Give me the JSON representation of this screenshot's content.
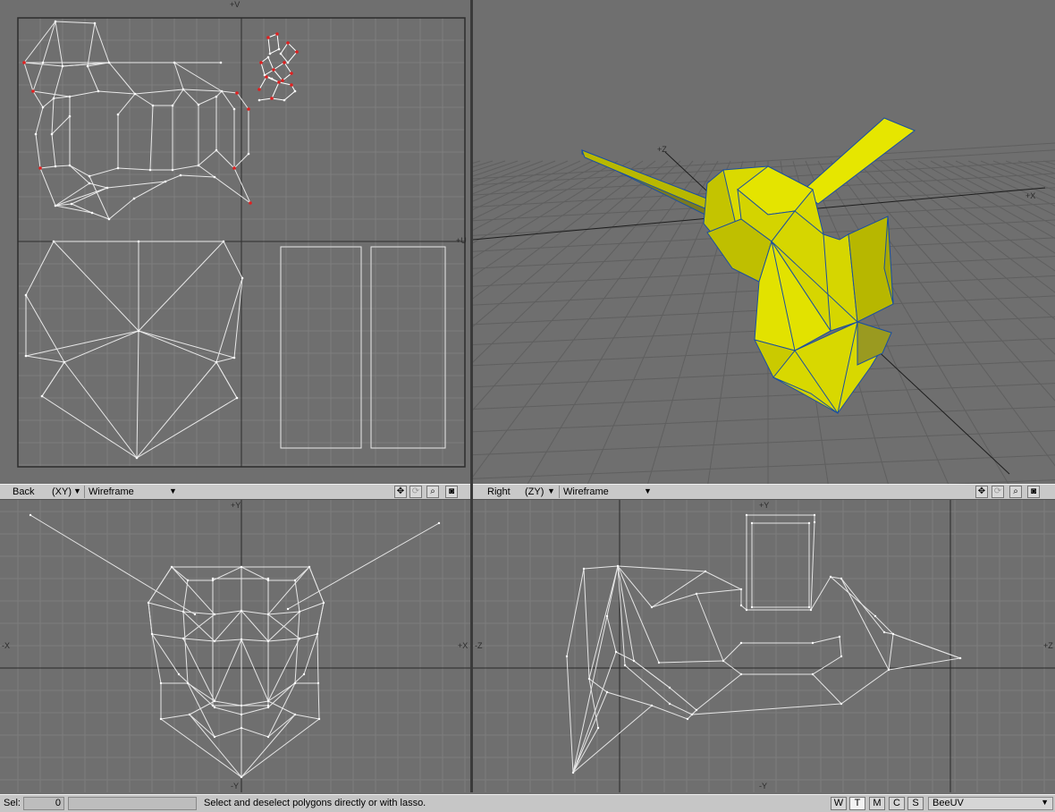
{
  "uv_view": {
    "axis_v": "+V",
    "axis_u": "+U"
  },
  "perspective": {
    "axis_z": "+Z",
    "axis_x": "+X"
  },
  "back_view": {
    "name": "Back",
    "axes": "(XY)",
    "render_mode": "Wireframe",
    "axis_labels": {
      "top": "+Y",
      "bottom": "-Y",
      "left": "-X",
      "right": "+X"
    }
  },
  "right_view": {
    "name": "Right",
    "axes": "(ZY)",
    "render_mode": "Wireframe",
    "axis_labels": {
      "top": "+Y",
      "bottom": "-Y",
      "left": "-Z",
      "right": "+Z"
    }
  },
  "status_bar": {
    "sel_label": "Sel:",
    "sel_count": "0",
    "message": "Select and deselect polygons directly or with lasso.",
    "modes": [
      "W",
      "T",
      "M",
      "C",
      "S"
    ],
    "active_mode": "T",
    "uv_map": "BeeUV"
  },
  "colors": {
    "viewport_bg": "#6f6f6f",
    "grid": "#7c7c7c",
    "wire": "#e6e6e6",
    "selected_point": "#e02020",
    "mesh_fill": "#e4e400",
    "mesh_edge": "#1a4fa0"
  },
  "icons": [
    "move-view-icon",
    "rotate-view-icon",
    "zoom-view-icon",
    "maximize-view-icon"
  ]
}
